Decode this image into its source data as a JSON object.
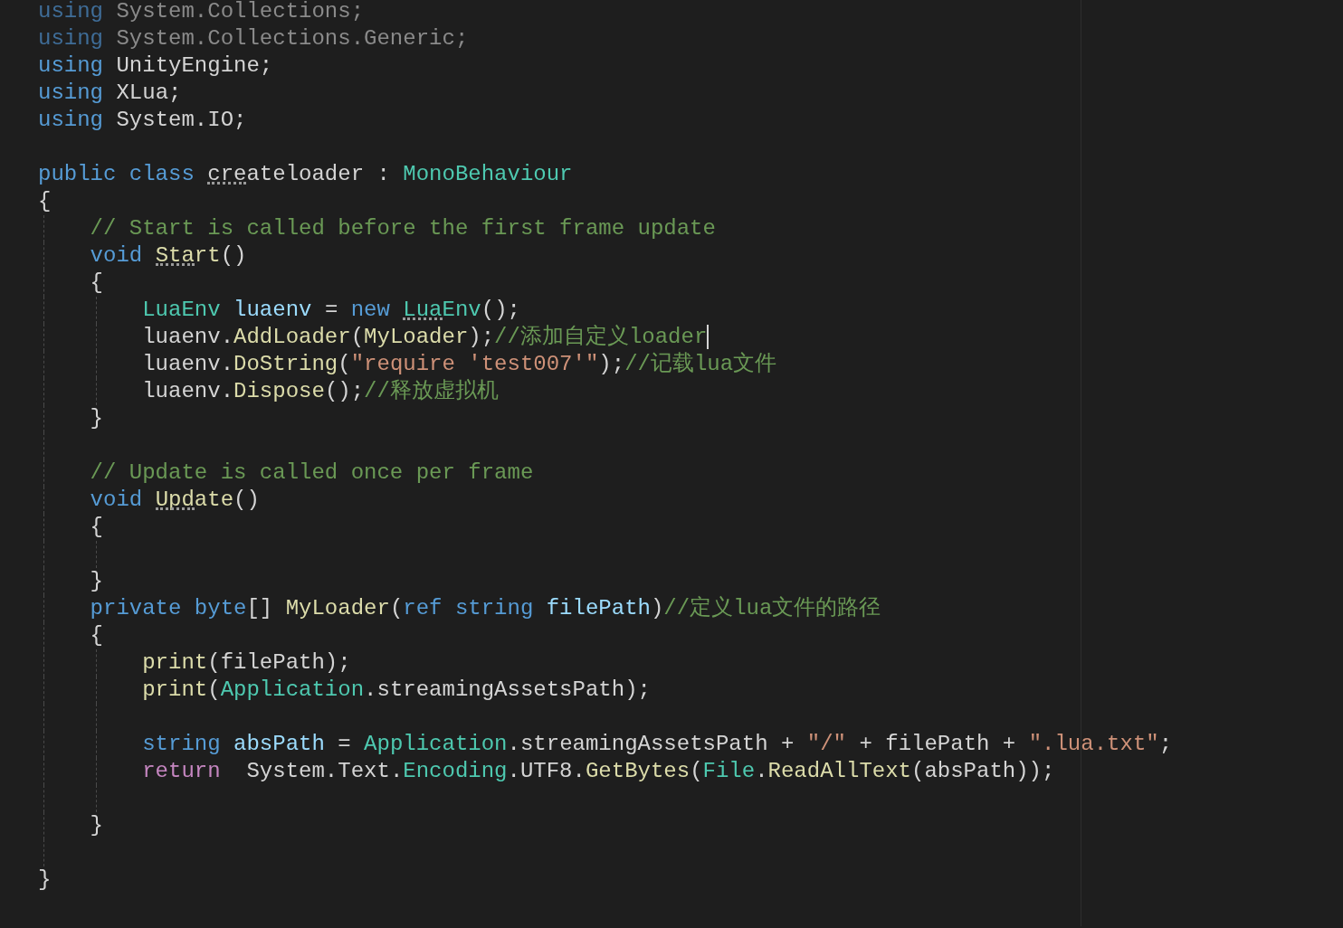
{
  "lines": [
    {
      "kind": "code",
      "tokens": [
        {
          "text": "using",
          "kind": "dimkeyword"
        },
        {
          "text": " System.Collections;",
          "kind": "dim"
        }
      ]
    },
    {
      "kind": "code",
      "tokens": [
        {
          "text": "using",
          "kind": "dimkeyword"
        },
        {
          "text": " System.Collections.Generic;",
          "kind": "dim"
        }
      ]
    },
    {
      "kind": "code",
      "tokens": [
        {
          "text": "using",
          "kind": "keyword"
        },
        {
          "text": " UnityEngine;",
          "kind": "plain"
        }
      ]
    },
    {
      "kind": "code",
      "tokens": [
        {
          "text": "using",
          "kind": "keyword"
        },
        {
          "text": " XLua;",
          "kind": "plain"
        }
      ]
    },
    {
      "kind": "code",
      "tokens": [
        {
          "text": "using",
          "kind": "keyword"
        },
        {
          "text": " System.IO;",
          "kind": "plain"
        }
      ]
    },
    {
      "kind": "blank"
    },
    {
      "kind": "code",
      "tokens": [
        {
          "text": "public class ",
          "kind": "keyword"
        },
        {
          "text": "createloader",
          "kind": "plain",
          "hinted": true
        },
        {
          "text": " : ",
          "kind": "plain"
        },
        {
          "text": "MonoBehaviour",
          "kind": "type"
        }
      ]
    },
    {
      "kind": "code",
      "tokens": [
        {
          "text": "{",
          "kind": "plain"
        }
      ]
    },
    {
      "kind": "code",
      "tokens": [
        {
          "text": "    // Start is called before the first frame update",
          "kind": "comment"
        }
      ]
    },
    {
      "kind": "code",
      "tokens": [
        {
          "text": "    void ",
          "kind": "keyword"
        },
        {
          "text": "Start",
          "kind": "method",
          "hinted": true
        },
        {
          "text": "()",
          "kind": "plain"
        }
      ]
    },
    {
      "kind": "code",
      "tokens": [
        {
          "text": "    {",
          "kind": "plain"
        }
      ]
    },
    {
      "kind": "code",
      "tokens": [
        {
          "text": "        LuaEnv ",
          "kind": "type"
        },
        {
          "text": "luaenv",
          "kind": "variable"
        },
        {
          "text": " = ",
          "kind": "plain"
        },
        {
          "text": "new ",
          "kind": "keyword"
        },
        {
          "text": "LuaEnv",
          "kind": "type",
          "hinted": true
        },
        {
          "text": "();",
          "kind": "plain"
        }
      ]
    },
    {
      "kind": "code",
      "tokens": [
        {
          "text": "        luaenv.",
          "kind": "plain"
        },
        {
          "text": "AddLoader",
          "kind": "method"
        },
        {
          "text": "(",
          "kind": "plain"
        },
        {
          "text": "MyLoader",
          "kind": "method"
        },
        {
          "text": ");",
          "kind": "plain"
        },
        {
          "text": "//添加自定义loader",
          "kind": "comment",
          "cursor": true
        }
      ]
    },
    {
      "kind": "code",
      "tokens": [
        {
          "text": "        luaenv.",
          "kind": "plain"
        },
        {
          "text": "DoString",
          "kind": "method"
        },
        {
          "text": "(",
          "kind": "plain"
        },
        {
          "text": "\"require 'test007'\"",
          "kind": "string"
        },
        {
          "text": ");",
          "kind": "plain"
        },
        {
          "text": "//记载lua文件",
          "kind": "comment"
        }
      ]
    },
    {
      "kind": "code",
      "tokens": [
        {
          "text": "        luaenv.",
          "kind": "plain"
        },
        {
          "text": "Dispose",
          "kind": "method"
        },
        {
          "text": "();",
          "kind": "plain"
        },
        {
          "text": "//释放虚拟机",
          "kind": "comment"
        }
      ]
    },
    {
      "kind": "code",
      "tokens": [
        {
          "text": "    }",
          "kind": "plain"
        }
      ]
    },
    {
      "kind": "blank"
    },
    {
      "kind": "code",
      "tokens": [
        {
          "text": "    // Update is called once per frame",
          "kind": "comment"
        }
      ]
    },
    {
      "kind": "code",
      "tokens": [
        {
          "text": "    void ",
          "kind": "keyword"
        },
        {
          "text": "Update",
          "kind": "method",
          "hinted": true
        },
        {
          "text": "()",
          "kind": "plain"
        }
      ]
    },
    {
      "kind": "code",
      "tokens": [
        {
          "text": "    {",
          "kind": "plain"
        }
      ]
    },
    {
      "kind": "blank"
    },
    {
      "kind": "code",
      "tokens": [
        {
          "text": "    }",
          "kind": "plain"
        }
      ]
    },
    {
      "kind": "code",
      "tokens": [
        {
          "text": "    private byte",
          "kind": "keyword"
        },
        {
          "text": "[] ",
          "kind": "plain"
        },
        {
          "text": "MyLoader",
          "kind": "method"
        },
        {
          "text": "(",
          "kind": "plain"
        },
        {
          "text": "ref string ",
          "kind": "keyword"
        },
        {
          "text": "filePath",
          "kind": "variable"
        },
        {
          "text": ")",
          "kind": "plain"
        },
        {
          "text": "//定义lua文件的路径",
          "kind": "comment"
        }
      ]
    },
    {
      "kind": "code",
      "tokens": [
        {
          "text": "    {",
          "kind": "plain"
        }
      ]
    },
    {
      "kind": "code",
      "tokens": [
        {
          "text": "        print",
          "kind": "method"
        },
        {
          "text": "(filePath);",
          "kind": "plain"
        }
      ]
    },
    {
      "kind": "code",
      "tokens": [
        {
          "text": "        print",
          "kind": "method"
        },
        {
          "text": "(",
          "kind": "plain"
        },
        {
          "text": "Application",
          "kind": "type"
        },
        {
          "text": ".streamingAssetsPath);",
          "kind": "plain"
        }
      ]
    },
    {
      "kind": "blank"
    },
    {
      "kind": "code",
      "tokens": [
        {
          "text": "        string ",
          "kind": "keyword"
        },
        {
          "text": "absPath",
          "kind": "variable"
        },
        {
          "text": " = ",
          "kind": "plain"
        },
        {
          "text": "Application",
          "kind": "type"
        },
        {
          "text": ".streamingAssetsPath + ",
          "kind": "plain"
        },
        {
          "text": "\"/\"",
          "kind": "string"
        },
        {
          "text": " + filePath + ",
          "kind": "plain"
        },
        {
          "text": "\".lua.txt\"",
          "kind": "string"
        },
        {
          "text": ";",
          "kind": "plain"
        }
      ]
    },
    {
      "kind": "code",
      "tokens": [
        {
          "text": "        return",
          "kind": "control"
        },
        {
          "text": "  System.Text.",
          "kind": "plain"
        },
        {
          "text": "Encoding",
          "kind": "type"
        },
        {
          "text": ".UTF8.",
          "kind": "plain"
        },
        {
          "text": "GetBytes",
          "kind": "method"
        },
        {
          "text": "(",
          "kind": "plain"
        },
        {
          "text": "File",
          "kind": "type"
        },
        {
          "text": ".",
          "kind": "plain"
        },
        {
          "text": "ReadAllText",
          "kind": "method"
        },
        {
          "text": "(absPath));",
          "kind": "plain"
        }
      ]
    },
    {
      "kind": "blank"
    },
    {
      "kind": "code",
      "tokens": [
        {
          "text": "    }",
          "kind": "plain"
        }
      ]
    },
    {
      "kind": "blank"
    },
    {
      "kind": "code",
      "tokens": [
        {
          "text": "}",
          "kind": "plain"
        }
      ]
    }
  ]
}
